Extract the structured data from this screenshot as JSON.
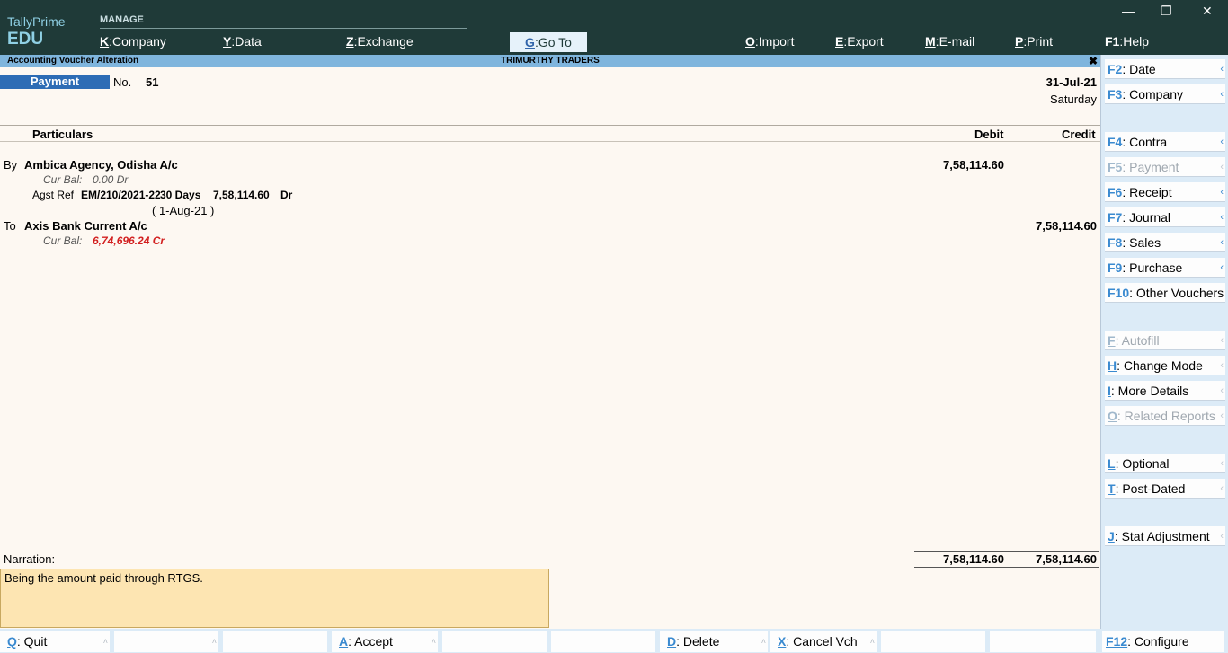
{
  "app": {
    "name": "TallyPrime",
    "edition": "EDU"
  },
  "menu": {
    "section": "MANAGE",
    "items": [
      {
        "key": "K",
        "label": "Company"
      },
      {
        "key": "Y",
        "label": "Data"
      },
      {
        "key": "Z",
        "label": "Exchange"
      }
    ],
    "goto": {
      "key": "G",
      "label": "Go To"
    },
    "right": [
      {
        "key": "O",
        "label": "Import"
      },
      {
        "key": "E",
        "label": "Export"
      },
      {
        "key": "M",
        "label": "E-mail"
      },
      {
        "key": "P",
        "label": "Print"
      },
      {
        "key": "F1",
        "label": "Help"
      }
    ]
  },
  "window": {
    "minimize": "—",
    "restore": "❐",
    "close": "✕"
  },
  "strip": {
    "title": "Accounting Voucher Alteration",
    "company": "TRIMURTHY TRADERS",
    "close": "✖"
  },
  "voucher": {
    "type": "Payment",
    "no_label": "No.",
    "no": "51",
    "date": "31-Jul-21",
    "day": "Saturday"
  },
  "columns": {
    "particulars": "Particulars",
    "debit": "Debit",
    "credit": "Credit"
  },
  "entries": [
    {
      "prefix": "By",
      "ledger": "Ambica Agency, Odisha A/c",
      "cur_bal_label": "Cur Bal:",
      "cur_bal": "0.00 Dr",
      "debit": "7,58,114.60",
      "ref": {
        "label": "Agst Ref",
        "name": "EM/210/2021-22",
        "days": "30 Days",
        "amount": "7,58,114.60",
        "type": "Dr",
        "due": "( 1-Aug-21 )"
      }
    },
    {
      "prefix": "To",
      "ledger": "Axis Bank Current A/c",
      "cur_bal_label": "Cur Bal:",
      "cur_bal": "6,74,696.24 Cr",
      "credit": "7,58,114.60"
    }
  ],
  "narration": {
    "label": "Narration:",
    "text": "Being the amount paid through RTGS."
  },
  "totals": {
    "debit": "7,58,114.60",
    "credit": "7,58,114.60"
  },
  "right_panel": [
    {
      "key": "F2",
      "label": "Date"
    },
    {
      "key": "F3",
      "label": "Company"
    },
    {
      "key": "F4",
      "label": "Contra"
    },
    {
      "key": "F5",
      "label": "Payment"
    },
    {
      "key": "F6",
      "label": "Receipt"
    },
    {
      "key": "F7",
      "label": "Journal"
    },
    {
      "key": "F8",
      "label": "Sales"
    },
    {
      "key": "F9",
      "label": "Purchase"
    },
    {
      "key": "F10",
      "label": "Other Vouchers"
    },
    {
      "key": "F",
      "label": "Autofill"
    },
    {
      "key": "H",
      "label": "Change Mode"
    },
    {
      "key": "I",
      "label": "More Details"
    },
    {
      "key": "O",
      "label": "Related Reports"
    },
    {
      "key": "L",
      "label": "Optional"
    },
    {
      "key": "T",
      "label": "Post-Dated"
    },
    {
      "key": "J",
      "label": "Stat Adjustment"
    }
  ],
  "bottom_bar": [
    {
      "key": "Q",
      "label": "Quit"
    },
    {
      "key": "A",
      "label": "Accept"
    },
    {
      "key": "D",
      "label": "Delete"
    },
    {
      "key": "X",
      "label": "Cancel Vch"
    },
    {
      "key": "F12",
      "label": "Configure"
    }
  ],
  "colors": {
    "topbar": "#1f3a38",
    "accent": "#2d6cb5",
    "strip": "#7fb5dd",
    "panel": "#dcebf7",
    "narration_bg": "#fde5b2",
    "negative": "#d21f1f"
  }
}
